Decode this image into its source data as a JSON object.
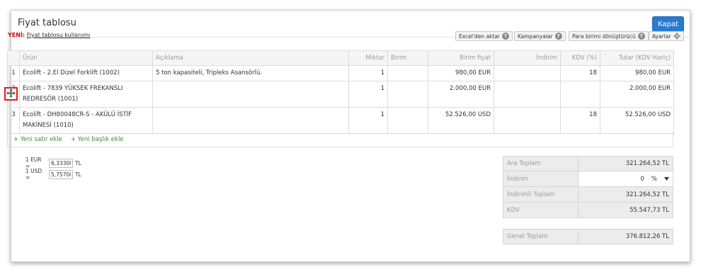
{
  "dialog": {
    "title": "Fiyat tablosu",
    "close_label": "Kapat"
  },
  "usage": {
    "new_label": "YENİ:",
    "link_text": "Fiyat tablosu kullanımı"
  },
  "toolbar": {
    "excel_label": "Excel'den aktar",
    "campaigns_label": "Kampanyalar",
    "currency_converter_label": "Para birimi dönüştürücü",
    "settings_label": "Ayarlar"
  },
  "table": {
    "headers": {
      "product": "Ürün",
      "description": "Açıklama",
      "quantity": "Miktar",
      "unit": "Birim",
      "unit_price": "Birim fiyat",
      "discount": "İndirim",
      "vat": "KDV (%)",
      "total": "Tutar (KDV Hariç)"
    },
    "rows": [
      {
        "no": "1",
        "product": "Ecolift - 2.El Dizel Forklift (1002)",
        "description": "5 ton kapasiteli, Tripleks Asansörlü.",
        "quantity": "1",
        "unit": "",
        "unit_price": "980,00 EUR",
        "discount": "",
        "vat": "18",
        "total": "980,00 EUR"
      },
      {
        "no": "2",
        "product": "Ecolift - 7839 YÜKSEK FREKANSLI REDRESÖR (1001)",
        "description": "",
        "quantity": "1",
        "unit": "",
        "unit_price": "2.000,00 EUR",
        "discount": "",
        "vat": "",
        "total": "2.000,00 EUR"
      },
      {
        "no": "3",
        "product": "Ecolift - DH80048CR-S - AKÜLÜ İSTİF MAKİNESİ (1010)",
        "description": "",
        "quantity": "1",
        "unit": "",
        "unit_price": "52.526,00 USD",
        "discount": "",
        "vat": "18",
        "total": "52.526,00 USD"
      }
    ],
    "add_row_label": "+ Yeni satır ekle",
    "add_header_label": "+ Yeni başlık ekle"
  },
  "rates": [
    {
      "label": "1 EUR =",
      "value": "6,33300",
      "currency": "TL"
    },
    {
      "label": "1 USD =",
      "value": "5,75700",
      "currency": "TL"
    }
  ],
  "totals": {
    "subtotal_label": "Ara Toplam",
    "subtotal_value": "321.264,52 TL",
    "discount_label": "İndirim",
    "discount_value": "0",
    "discount_unit": "%",
    "discounted_total_label": "İndirimli Toplam",
    "discounted_total_value": "321.264,52 TL",
    "vat_label": "KDV",
    "vat_value": "55.547,73 TL",
    "grand_total_label": "Genel Toplam",
    "grand_total_value": "376.812,26 TL"
  },
  "colors": {
    "primary_button": "#2a7ad0",
    "new_label": "#d0021b",
    "add_link": "#3c8c3c",
    "drag_highlight": "#e01b1b"
  }
}
